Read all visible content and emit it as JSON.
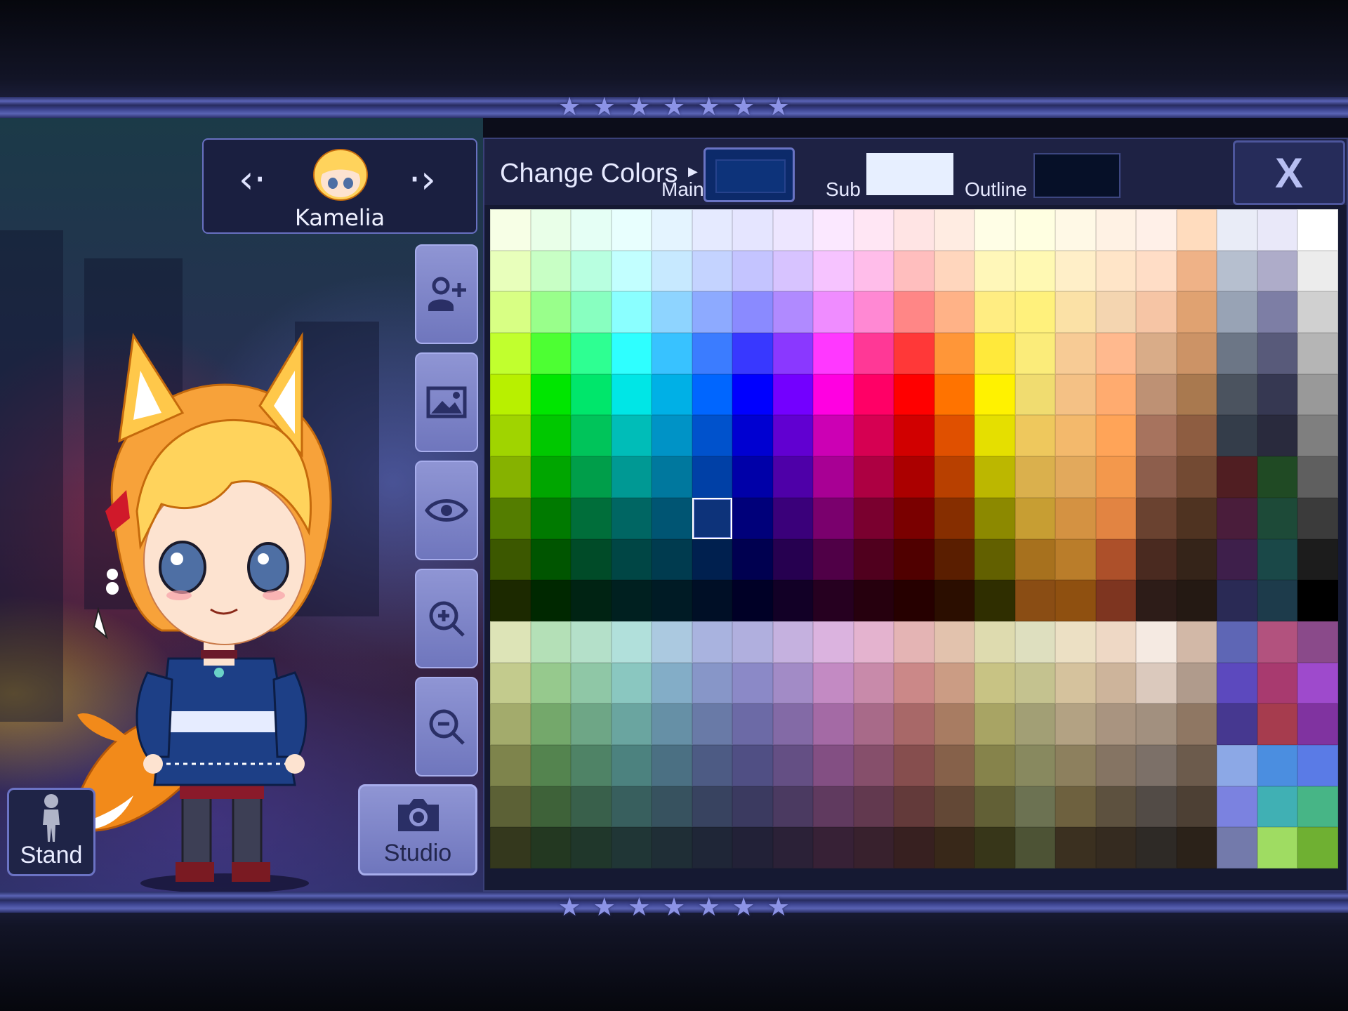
{
  "character": {
    "name": "Kamelia",
    "prev_label": "<",
    "next_label": ">"
  },
  "side_buttons": [
    {
      "name": "add-character-button",
      "icon": "add-user-icon"
    },
    {
      "name": "background-button",
      "icon": "image-icon"
    },
    {
      "name": "visibility-button",
      "icon": "eye-icon"
    },
    {
      "name": "zoom-in-button",
      "icon": "zoom-in-icon"
    },
    {
      "name": "zoom-out-button",
      "icon": "zoom-out-icon"
    }
  ],
  "stand_button": {
    "label": "Stand",
    "icon": "mannequin-icon"
  },
  "studio_button": {
    "label": "Studio",
    "icon": "camera-icon"
  },
  "panel": {
    "title": "Change Colors",
    "main_label": "Main",
    "sub_label": "Sub",
    "outline_label": "Outline",
    "main_color": "#0d337a",
    "sub_color": "#e7efff",
    "outline_color": "#061028",
    "close_label": "X"
  },
  "palette": {
    "selected": "7,5",
    "rows": [
      [
        "#f7ffe6",
        "#e9ffe8",
        "#e5fff5",
        "#e8fffe",
        "#e4f4ff",
        "#e5eaff",
        "#e5e5ff",
        "#ede6ff",
        "#fbe8ff",
        "#ffe6f4",
        "#ffe4e4",
        "#ffece2",
        "#fffee6",
        "#ffffe1",
        "#fff9e6",
        "#fff2e4",
        "#fff0e8",
        "#ffdcbe",
        "#e9ecf7",
        "#e9e8f9",
        "#ffffff"
      ],
      [
        "#e8ffbb",
        "#c8ffc5",
        "#b8ffe0",
        "#c2ffff",
        "#c7e9ff",
        "#c4d3ff",
        "#c4c4ff",
        "#d7c3ff",
        "#f6c3ff",
        "#ffbdea",
        "#ffbebe",
        "#ffd6bd",
        "#fff7b9",
        "#fff9b3",
        "#ffefc8",
        "#ffe5c8",
        "#ffddc6",
        "#efb287",
        "#b6bfcf",
        "#aeacc9",
        "#ececec"
      ],
      [
        "#d8ff84",
        "#99ff8b",
        "#88ffc0",
        "#8affff",
        "#8ed4ff",
        "#8daaff",
        "#8a8aff",
        "#b08aff",
        "#ef8cff",
        "#ff88d3",
        "#ff8686",
        "#ffb287",
        "#ffed82",
        "#fff17c",
        "#fbe1a6",
        "#f4d5b0",
        "#f6c5a5",
        "#e0a271",
        "#98a3b5",
        "#7d7ea5",
        "#d0d0d0"
      ],
      [
        "#c1ff2e",
        "#4dff33",
        "#2eff92",
        "#2effff",
        "#38c2ff",
        "#3b7cff",
        "#3838ff",
        "#8a38ff",
        "#ff38ff",
        "#ff3896",
        "#ff3838",
        "#ff9638",
        "#ffe93b",
        "#fbec7a",
        "#f7cb95",
        "#ffb98e",
        "#d9ac88",
        "#cc9366",
        "#6c7686",
        "#585a7a",
        "#b5b5b5"
      ],
      [
        "#b8f000",
        "#00e600",
        "#00e66b",
        "#00e6e6",
        "#00b0e6",
        "#0066ff",
        "#0000ff",
        "#7300ff",
        "#ff00e1",
        "#ff0066",
        "#ff0000",
        "#ff7300",
        "#fff200",
        "#f0dc70",
        "#f4c185",
        "#ffab6f",
        "#be9174",
        "#a9794f",
        "#4b535f",
        "#363852",
        "#999999"
      ],
      [
        "#a0d400",
        "#00c800",
        "#00c45a",
        "#00bdb8",
        "#0093c6",
        "#0052cc",
        "#0000d1",
        "#6100d1",
        "#cc00b4",
        "#d60052",
        "#d10000",
        "#e05000",
        "#e5df00",
        "#eec85d",
        "#f3b96c",
        "#ffa458",
        "#a7735e",
        "#8e5d41",
        "#343d4a",
        "#292a3d",
        "#7f7f7f"
      ],
      [
        "#86b200",
        "#00a600",
        "#009e4a",
        "#009994",
        "#00789e",
        "#0040a6",
        "#0000a8",
        "#4e00a8",
        "#a80094",
        "#ad0042",
        "#ab0000",
        "#b84000",
        "#bcb700",
        "#dab04d",
        "#e2a95c",
        "#f3984c",
        "#8d5e4c",
        "#734a33",
        "#501e22",
        "#204a24",
        "#5f5f5f"
      ],
      [
        "#547d00",
        "#007a00",
        "#006e3a",
        "#006663",
        "#005573",
        "#0d337a",
        "#00007a",
        "#3a007a",
        "#7a006d",
        "#7a002f",
        "#7a0000",
        "#862e00",
        "#8c8900",
        "#c79e33",
        "#d49242",
        "#e28442",
        "#6a4230",
        "#4f3321",
        "#4a1d3b",
        "#1d4a38",
        "#3b3b3b"
      ],
      [
        "#3c5800",
        "#005500",
        "#004b28",
        "#004645",
        "#003b4f",
        "#00204f",
        "#000050",
        "#260050",
        "#500047",
        "#50001e",
        "#500000",
        "#5a1e00",
        "#626000",
        "#a7711e",
        "#ba7d2a",
        "#ad502a",
        "#4a2a20",
        "#352419",
        "#3e1f4b",
        "#1a4848",
        "#1c1c1c"
      ],
      [
        "#1c2900",
        "#002800",
        "#002313",
        "#002020",
        "#001b25",
        "#000f26",
        "#000026",
        "#120026",
        "#260020",
        "#26000e",
        "#260000",
        "#2b0e00",
        "#2f2e00",
        "#8a4d14",
        "#8f5010",
        "#7e3520",
        "#2d1c18",
        "#241913",
        "#2a2a55",
        "#1d3b4b",
        "#000000"
      ],
      [
        "#dde4b7",
        "#b4e0b7",
        "#b4e0c9",
        "#b1e0db",
        "#abc9e0",
        "#a9b3df",
        "#b0afde",
        "#c5b1df",
        "#dbb3df",
        "#e4b3cf",
        "#e4b4b4",
        "#e2c2ad",
        "#dedbaf",
        "#dedfbf",
        "#ece0c4",
        "#eed8c5",
        "#f5eae2",
        "#d2b8a7",
        "#5e66b5",
        "#b2527e",
        "#8a4a8a"
      ],
      [
        "#c3cb8d",
        "#96c98d",
        "#8fc7a6",
        "#8ac7c0",
        "#83adc7",
        "#8796c8",
        "#8b89c7",
        "#a28bc6",
        "#c38ac3",
        "#c88aaa",
        "#cb8888",
        "#cb9c84",
        "#c8c384",
        "#c4c28f",
        "#d5c29d",
        "#cdb49b",
        "#dbc9bd",
        "#b09b8c",
        "#5c49be",
        "#a83a6f",
        "#9e4acc"
      ],
      [
        "#a3ab6c",
        "#74a86b",
        "#6ea686",
        "#6aa5a0",
        "#6690a6",
        "#697aa7",
        "#6c6aa6",
        "#836aa6",
        "#a46aa5",
        "#a86a89",
        "#a86868",
        "#a87c62",
        "#a8a464",
        "#a29f75",
        "#b3a283",
        "#a99480",
        "#a2907f",
        "#8f7763",
        "#463890",
        "#a63c4e",
        "#8033a0"
      ],
      [
        "#7e844c",
        "#54844f",
        "#4f8366",
        "#4c827f",
        "#4b7083",
        "#4d5b84",
        "#504f84",
        "#644f84",
        "#834f83",
        "#864f6b",
        "#864e4e",
        "#86614a",
        "#86834b",
        "#88895f",
        "#8d805e",
        "#857463",
        "#7c7068",
        "#6c5b4c",
        "#8ca8e6",
        "#4b8ee0",
        "#5a7be6"
      ],
      [
        "#5c6136",
        "#3e6239",
        "#39604b",
        "#385f5e",
        "#37525f",
        "#384360",
        "#3b3a60",
        "#4b3a61",
        "#603a5f",
        "#62394f",
        "#633a3a",
        "#634836",
        "#626036",
        "#6c7252",
        "#6e613f",
        "#5d513f",
        "#524b46",
        "#4d4034",
        "#7b82e0",
        "#40b0b4",
        "#47b586"
      ],
      [
        "#34381d",
        "#233821",
        "#20372b",
        "#203636",
        "#1f2e36",
        "#1f2637",
        "#222137",
        "#2b2137",
        "#372136",
        "#38212d",
        "#372020",
        "#382819",
        "#373619",
        "#4d5335",
        "#3b3020",
        "#352b20",
        "#2e2a26",
        "#2b2219",
        "#737aab",
        "#9fdc62",
        "#6fb032"
      ]
    ]
  }
}
